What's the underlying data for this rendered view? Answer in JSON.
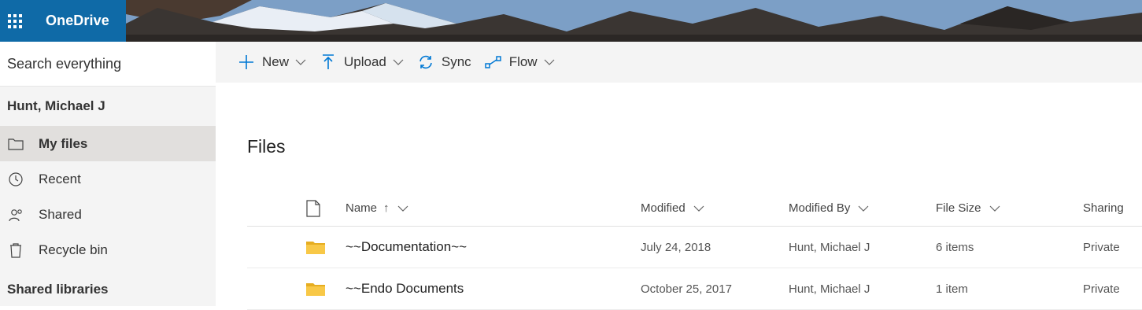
{
  "app": {
    "name": "OneDrive"
  },
  "search": {
    "placeholder": "Search everything"
  },
  "user": {
    "name": "Hunt, Michael J"
  },
  "nav": {
    "items": [
      {
        "label": "My files",
        "icon": "folder-icon",
        "active": true
      },
      {
        "label": "Recent",
        "icon": "history-icon",
        "active": false
      },
      {
        "label": "Shared",
        "icon": "people-icon",
        "active": false
      },
      {
        "label": "Recycle bin",
        "icon": "recycle-bin-icon",
        "active": false
      }
    ],
    "section_title": "Shared libraries"
  },
  "commands": {
    "new_label": "New",
    "upload_label": "Upload",
    "sync_label": "Sync",
    "flow_label": "Flow"
  },
  "page": {
    "title": "Files"
  },
  "table": {
    "columns": {
      "name": "Name",
      "modified": "Modified",
      "modified_by": "Modified By",
      "file_size": "File Size",
      "sharing": "Sharing"
    },
    "sort_indicator": "↑",
    "rows": [
      {
        "name": "~~Documentation~~",
        "modified": "July 24, 2018",
        "modified_by": "Hunt, Michael J",
        "file_size": "6 items",
        "sharing": "Private"
      },
      {
        "name": "~~Endo Documents",
        "modified": "October 25, 2017",
        "modified_by": "Hunt, Michael J",
        "file_size": "1 item",
        "sharing": "Private"
      }
    ]
  },
  "colors": {
    "brand": "#0f6aa7",
    "accent": "#0078d4",
    "folder": "#f8c847",
    "nav_bg": "#f4f4f4",
    "nav_active": "#e1dfdd"
  }
}
